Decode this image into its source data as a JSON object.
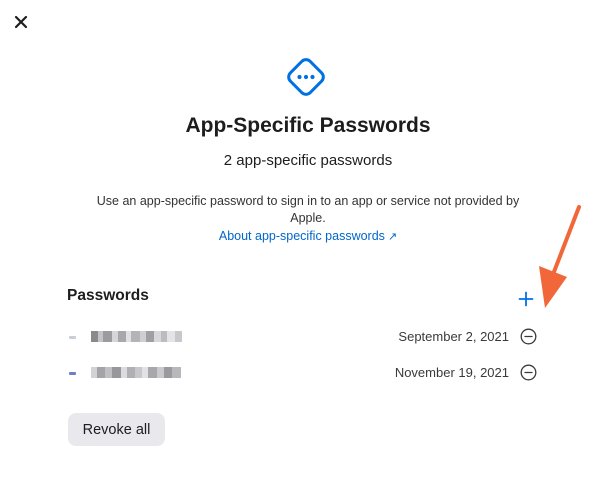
{
  "window": {
    "close_icon": "close-icon"
  },
  "header": {
    "icon": "dots-diamond-icon",
    "title": "App-Specific Passwords",
    "count_text": "2 app-specific passwords",
    "description": "Use an app-specific password to sign in to an app or service not provided by Apple.",
    "about_link": "About app-specific passwords",
    "about_link_icon": "external-arrow-icon"
  },
  "passwords_section": {
    "title": "Passwords",
    "add_icon": "plus-icon",
    "items": [
      {
        "date": "September 2, 2021",
        "remove_icon": "minus-circle-icon"
      },
      {
        "date": "November 19, 2021",
        "remove_icon": "minus-circle-icon"
      }
    ]
  },
  "footer": {
    "revoke_label": "Revoke all"
  },
  "colors": {
    "accent": "#0071e3",
    "link": "#0066cc",
    "annotation": "#f2673a",
    "button_bg": "#e8e8ed"
  }
}
